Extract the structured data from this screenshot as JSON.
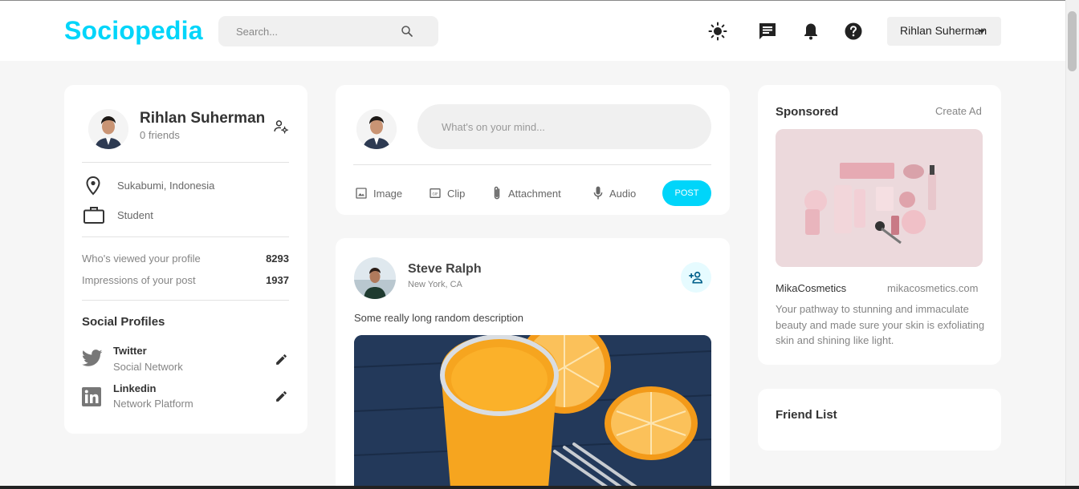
{
  "brand": {
    "name": "Sociopedia",
    "accent": "#00d5fa"
  },
  "search": {
    "placeholder": "Search..."
  },
  "navbar": {
    "icons": [
      "light-mode-icon",
      "message-icon",
      "notification-icon",
      "help-icon"
    ],
    "user_name": "Rihlan Suherman"
  },
  "profile": {
    "name": "Rihlan Suherman",
    "friends": "0 friends",
    "location": "Sukabumi, Indonesia",
    "occupation": "Student",
    "stats": [
      {
        "label": "Who's viewed your profile",
        "value": "8293"
      },
      {
        "label": "Impressions of your post",
        "value": "1937"
      }
    ],
    "social_title": "Social Profiles",
    "socials": [
      {
        "name": "Twitter",
        "type": "Social Network",
        "icon": "twitter-icon"
      },
      {
        "name": "Linkedin",
        "type": "Network Platform",
        "icon": "linkedin-icon"
      }
    ]
  },
  "compose": {
    "placeholder": "What's on your mind...",
    "tools": [
      "Image",
      "Clip",
      "Attachment",
      "Audio"
    ],
    "post_label": "POST"
  },
  "post": {
    "author": "Steve Ralph",
    "location": "New York, CA",
    "description": "Some really long random description",
    "image_icon": "orange-juice-photo"
  },
  "ad": {
    "title": "Sponsored",
    "create_label": "Create Ad",
    "brand": "MikaCosmetics",
    "site": "mikacosmetics.com",
    "description": "Your pathway to stunning and immaculate beauty and made sure your skin is exfoliating skin and shining like light."
  },
  "friends": {
    "title": "Friend List"
  }
}
